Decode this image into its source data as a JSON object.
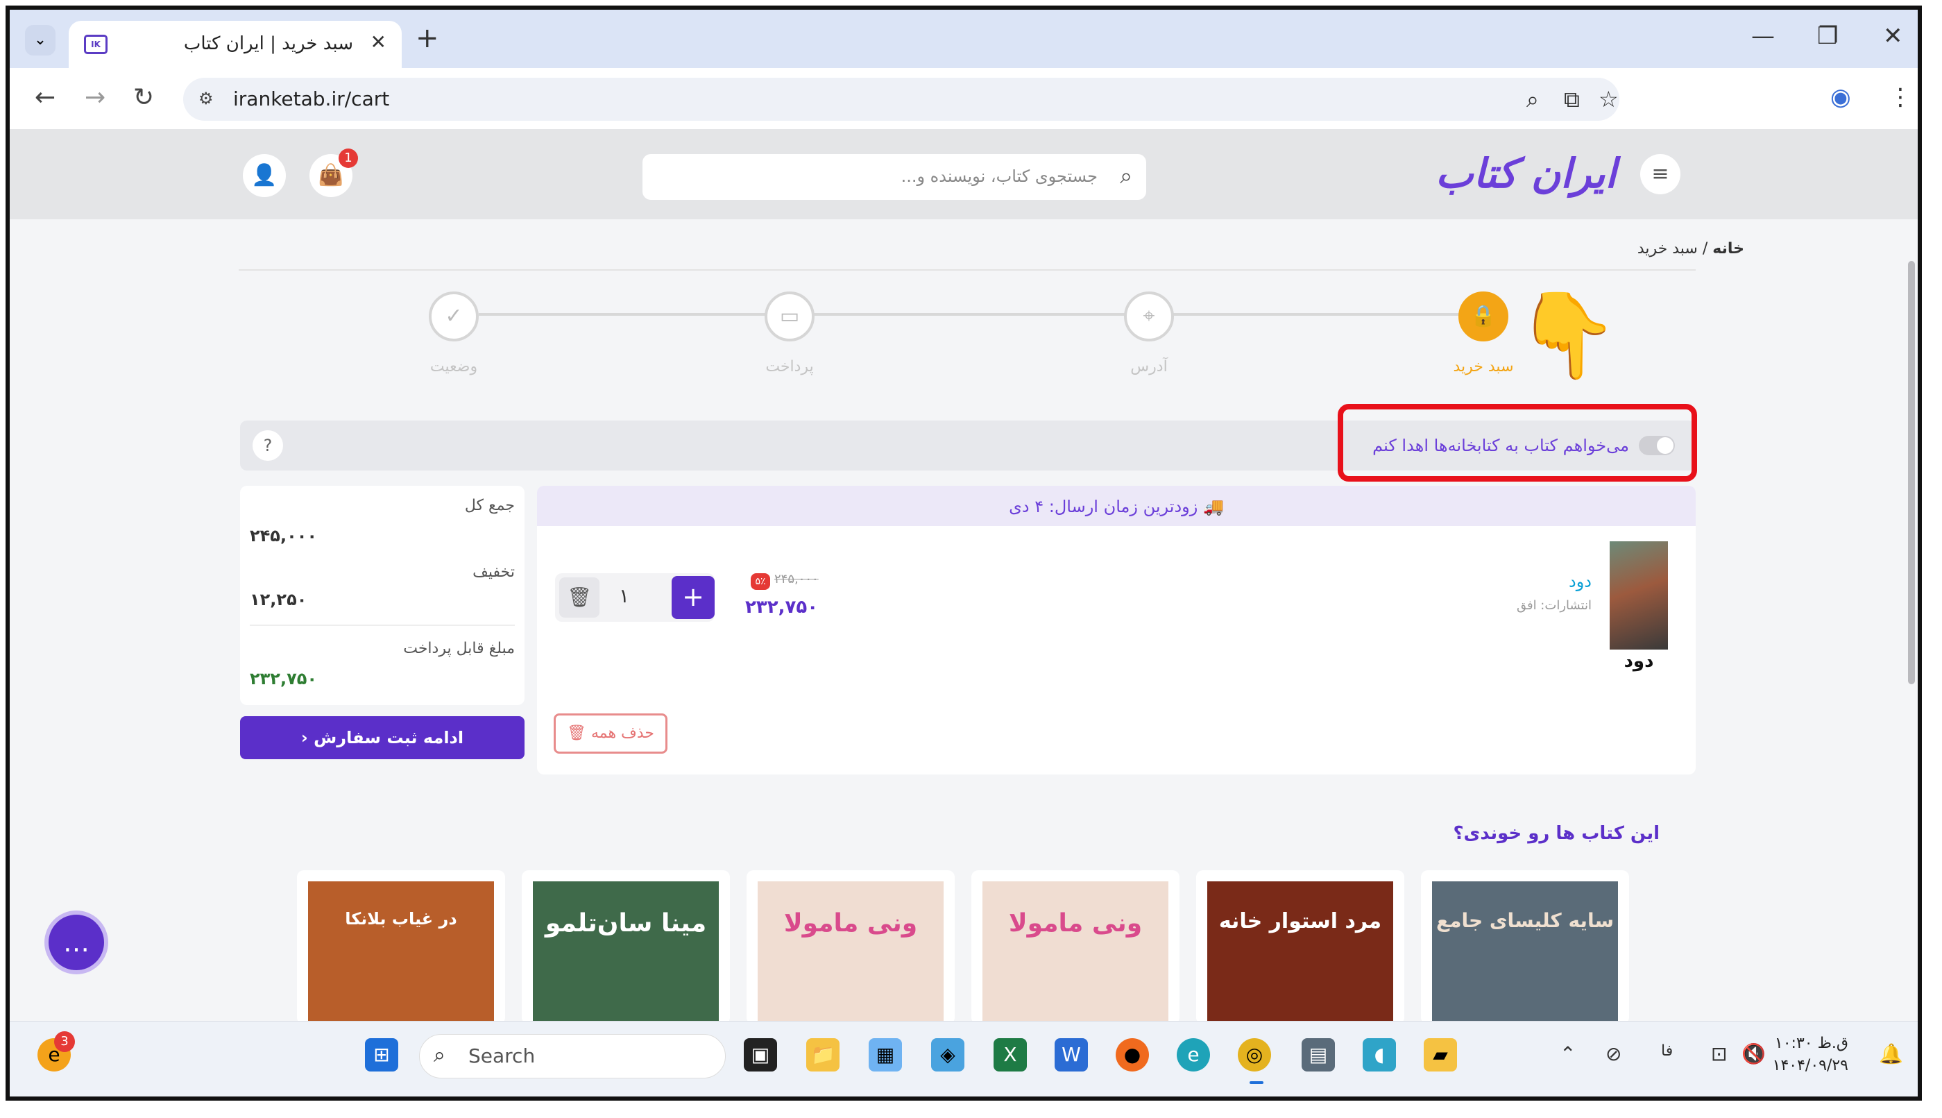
{
  "browser": {
    "tab_title": "سبد خرید | ایران کتاب",
    "tab_close": "✕",
    "new_tab": "+",
    "url": "iranketab.ir/cart",
    "minimize": "—",
    "restore": "❐",
    "close": "✕"
  },
  "site": {
    "logo": "ایران کتاب",
    "search_placeholder": "جستجوی کتاب، نویسنده و...",
    "cart_count": "1",
    "breadcrumb_home": "خانه",
    "breadcrumb_sep": "/",
    "breadcrumb_current": "سبد خرید",
    "steps": [
      {
        "label": "سبد خرید",
        "icon": "shopping-bag-icon"
      },
      {
        "label": "آدرس",
        "icon": "location-pin-icon"
      },
      {
        "label": "پرداخت",
        "icon": "credit-card-icon"
      },
      {
        "label": "وضعیت",
        "icon": "check-circle-icon"
      }
    ],
    "donate_text": "می‌خواهم کتاب به کتابخانه‌ها اهدا کنم",
    "donate_enabled": false,
    "help": "?",
    "shipping_note": "زودترین زمان ارسال: ۴ دی",
    "item": {
      "title": "دود",
      "cover_title": "دود",
      "publisher": "انتشارات: افق",
      "discount_badge": "۵٪",
      "old_price": "۲۴۵,۰۰۰",
      "price": "۲۳۲,۷۵۰",
      "quantity": "۱"
    },
    "delete_all": "حذف همه",
    "summary": {
      "total_label": "جمع کل",
      "total_value": "۲۴۵,۰۰۰",
      "discount_label": "تخفیف",
      "discount_value": "۱۲,۲۵۰",
      "payable_label": "مبلغ قابل پرداخت",
      "payable_value": "۲۳۲,۷۵۰"
    },
    "continue_button": "ادامه ثبت سفارش",
    "recommend_title": "این کتاب ها رو خوندی؟",
    "recommendations": [
      {
        "title": "سایه کلیسای جامع",
        "color": "#5a6b78"
      },
      {
        "title": "مرد استوار خانه",
        "color": "#7a2a18"
      },
      {
        "title": "ونی مامولا",
        "color": "#f0ddd2"
      },
      {
        "title": "ونی مامولا",
        "color": "#f0ddd2"
      },
      {
        "title": "مینا سان‌تلمو",
        "color": "#3f6a4a"
      },
      {
        "title": "در غیاب بلانکا",
        "color": "#b85e2a"
      }
    ]
  },
  "taskbar": {
    "search_label": "Search",
    "edge_badge": "3",
    "clock_time": "۱۰:۳۰ ق.ظ",
    "clock_date": "۱۴۰۴/۰۹/۲۹",
    "lang": "فا"
  },
  "colors": {
    "accent": "#5b2fc9",
    "step_active": "#f3a516",
    "highlight_box": "#e8101a"
  }
}
